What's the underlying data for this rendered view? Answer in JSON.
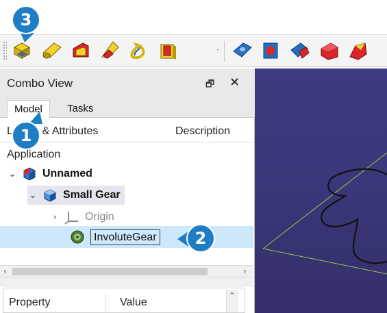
{
  "toolbar": {
    "icons": [
      "part-box-icon",
      "part-cylinder-icon",
      "part-wedge-icon",
      "part-cone-icon",
      "part-helix-icon",
      "shape-builder-icon",
      "dropdown-arrow-icon",
      "extrude-icon",
      "revolve-icon",
      "mirror-icon",
      "fillet-icon",
      "chamfer-icon"
    ],
    "dropdown_glyph": "·"
  },
  "combo_view": {
    "title": "Combo View",
    "float_glyph": "🗗",
    "close_glyph": "×",
    "tabs": [
      {
        "label": "Model"
      },
      {
        "label": "Tasks"
      }
    ],
    "tree_header": {
      "labels": "Labels & Attributes",
      "description": "Description"
    },
    "application_label": "Application",
    "tree": {
      "unnamed": "Unnamed",
      "small_gear": "Small Gear",
      "origin": "Origin",
      "involute_gear": "InvoluteGear"
    },
    "property_panel": {
      "property": "Property",
      "value": "Value"
    }
  },
  "callouts": {
    "one": "1",
    "two": "2",
    "three": "3"
  },
  "colors": {
    "accent": "#1d7ec6",
    "selection": "#cde8fb",
    "viewport": "#3a3779",
    "part_yellow": "#f2d32a",
    "part_red": "#d9262b",
    "part_blue": "#1f6fc2"
  }
}
